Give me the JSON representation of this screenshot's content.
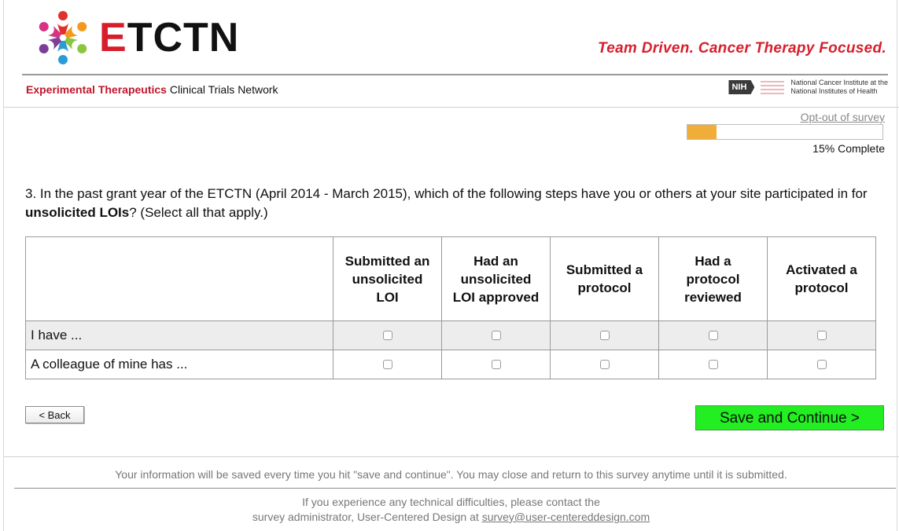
{
  "header": {
    "logo_letter_e": "E",
    "logo_letters_rest": "TCTN",
    "tagline": "Team Driven. Cancer Therapy Focused.",
    "network_red": "Experimental Therapeutics",
    "network_rest": " Clinical Trials Network",
    "nih_badge": "NIH",
    "nci_line1": "National Cancer Institute at the",
    "nci_line2": "National Institutes of Health"
  },
  "progress": {
    "optout_label": "Opt-out of survey",
    "percent": 15,
    "label": "15% Complete"
  },
  "question": {
    "text_before": "3. In the past grant year of the ETCTN (April 2014 - March 2015), which of the following steps have you or others at your site participated in for ",
    "text_bold": "unsolicited LOIs",
    "text_after": "? (Select all that apply.)"
  },
  "grid": {
    "columns": [
      "Submitted an unsolicited LOI",
      "Had an unsolicited LOI approved",
      "Submitted a protocol",
      "Had a protocol reviewed",
      "Activated a protocol"
    ],
    "rows": [
      "I have ...",
      "A colleague of mine has ..."
    ]
  },
  "buttons": {
    "back": "< Back",
    "save": "Save and Continue >"
  },
  "footer": {
    "save_info": "Your information will be saved every time you hit \"save and continue\". You may close and return to this survey anytime until it is submitted.",
    "contact_line1": "If you experience any technical difficulties, please contact the",
    "contact_line2": "survey administrator, User-Centered Design at ",
    "contact_email": "survey@user-centereddesign.com"
  },
  "colors": {
    "brand_red": "#d81e2c",
    "progress_fill": "#f0ad3a",
    "save_button": "#22ee22"
  }
}
